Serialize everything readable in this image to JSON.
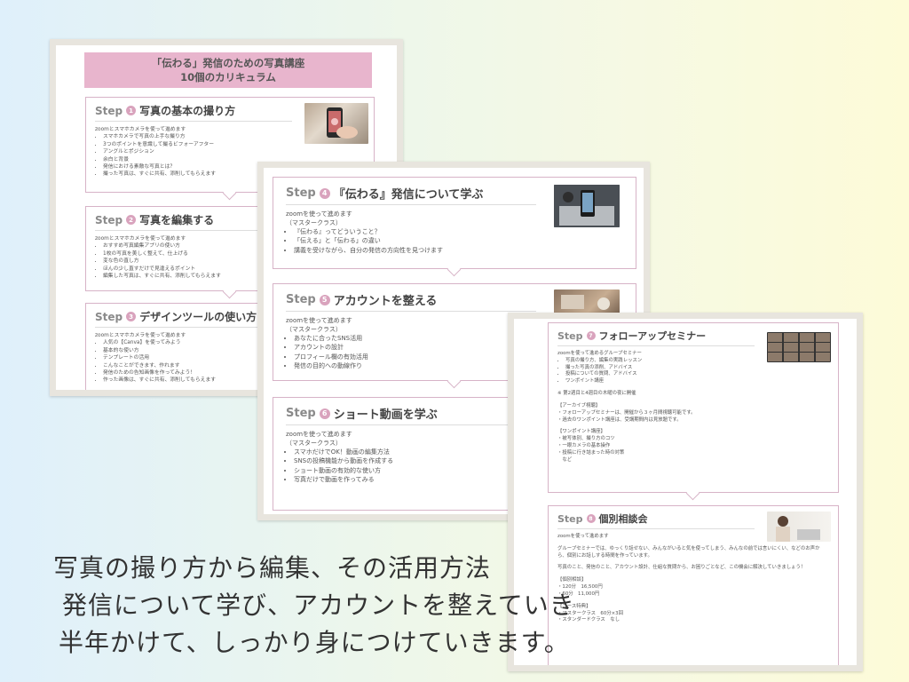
{
  "sheet1": {
    "header_line1": "「伝わる」発信のための写真講座",
    "header_line2": "10個のカリキュラム",
    "steps": [
      {
        "word": "Step",
        "num": "1",
        "title": "写真の基本の撮り方",
        "intro": "zoomとスマホカメラを使って進めます",
        "items": [
          "スマホカメラで写真の上手な撮り方",
          "3つのポイントを意識して撮るビフォーアフター",
          "アングルとポジション",
          "余白と背景",
          "発信における素敵な写真とは？",
          "撮った写真は、すぐに共有、添削してもらえます"
        ]
      },
      {
        "word": "Step",
        "num": "2",
        "title": "写真を編集する",
        "intro": "zoomとスマホカメラを使って進めます",
        "items": [
          "おすすめ写真編集アプリの使い方",
          "1枚の写真を美しく整えて、仕上げる",
          "変な色の直し方",
          "ほんの少し直すだけで見違えるポイント",
          "編集した写真は、すぐに共有、添削してもらえます"
        ]
      },
      {
        "word": "Step",
        "num": "3",
        "title": "デザインツールの使い方",
        "intro": "zoomとスマホカメラを使って進めます",
        "items": [
          "人気の【Canva】を使ってみよう",
          "基本的な使い方",
          "テンプレートの活用",
          "こんなことができます、作れます",
          "発信のための告知画像を作ってみよう！",
          "作った画像は、すぐに共有、添削してもらえます"
        ]
      }
    ]
  },
  "sheet2": {
    "steps": [
      {
        "word": "Step",
        "num": "4",
        "title": "『伝わる』発信について学ぶ",
        "intro": "zoomを使って進めます",
        "sub": "（マスタークラス）",
        "items": [
          "『伝わる』ってどういうこと？",
          "「伝える」と「伝わる」の違い",
          "講義を受けながら、自分の発信の方向性を見つけます"
        ]
      },
      {
        "word": "Step",
        "num": "5",
        "title": "アカウントを整える",
        "intro": "zoomを使って進めます",
        "sub": "（マスタークラス）",
        "items": [
          "あなたに合ったSNS活用",
          "アカウントの設計",
          "プロフィール欄の有効活用",
          "発信の目的への動線作り"
        ]
      },
      {
        "word": "Step",
        "num": "6",
        "title": "ショート動画を学ぶ",
        "intro": "zoomを使って進めます",
        "sub": "（マスタークラス）",
        "items": [
          "スマホだけでOK！動画の編集方法",
          "SNSの投稿機能から動画を作成する",
          "ショート動画の有効的な使い方",
          "写真だけで動画を作ってみる"
        ]
      }
    ]
  },
  "sheet3": {
    "step7": {
      "word": "Step",
      "num": "7",
      "title": "フォローアップセミナー",
      "intro": "zoomを使って進めるグループセミナー",
      "items": [
        "写真の撮り方、編集の実践レッスン",
        "撮った写真の添削、アドバイス",
        "投稿についての質問、アドバイス",
        "ワンポイント講座"
      ],
      "note": "※ 第2週目と4週目の木曜の夜に開催",
      "archive_head": "【アーカイブ視聴】",
      "archive_lines": "・フォローアップセミナーは、開催から３ヶ月間視聴可能です。\n・過去のワンポイント講座は、受講期間内は見放題です。",
      "onepoint_head": "【ワンポイント講座】",
      "onepoint_lines": "・被写体別、撮り方のコツ\n・一眼カメラの基本操作\n・投稿に行き詰まった時の対策\n　など"
    },
    "step8": {
      "word": "Step",
      "num": "8",
      "title": "個別相談会",
      "intro": "zoomを使って進めます",
      "para1": "グループセミナーでは、ゆっくり話せない、みんながいると気を使ってしまう、みんなの前では言いにくい、などのお声から、個別にお話しする時間を作っています。",
      "para2": "写真のこと、発信のこと、アカウント設計、仕組な質問から、お困りごとなど、この機会に解決していきましょう！",
      "fee_head": "【個別相談】",
      "fee_lines": "・120分　16,500円\n・60分　11,000円",
      "course_head": "【コース特典】",
      "course_lines": "・マスタークラス　60分×3回\n・スタンダードクラス　なし"
    }
  },
  "caption": {
    "line1": "写真の撮り方から編集、その活用方法",
    "line2": "発信について学び、アカウントを整えていき",
    "line3": "半年かけて、しっかり身につけていきます。"
  },
  "colors": {
    "accent_pink": "#d9a3bd",
    "header_band": "#e8b5cd",
    "frame": "#e8e5de"
  },
  "icons": [
    "phone-photo-thumbnail",
    "laptop-thumbnail",
    "desk-thumbnail",
    "video-call-grid-thumbnail",
    "woman-laptop-thumbnail"
  ]
}
